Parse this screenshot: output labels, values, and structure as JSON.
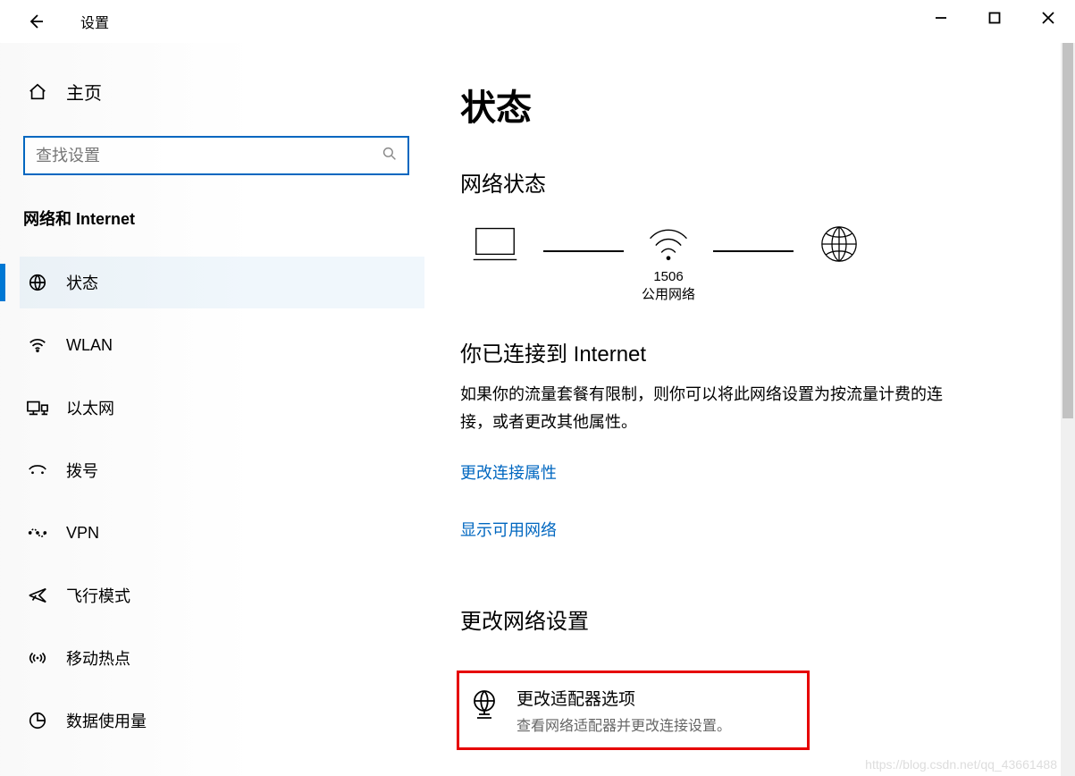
{
  "titlebar": {
    "app_name": "设置"
  },
  "sidebar": {
    "home_label": "主页",
    "search_placeholder": "查找设置",
    "section_title": "网络和 Internet",
    "items": [
      {
        "label": "状态",
        "selected": true
      },
      {
        "label": "WLAN"
      },
      {
        "label": "以太网"
      },
      {
        "label": "拨号"
      },
      {
        "label": "VPN"
      },
      {
        "label": "飞行模式"
      },
      {
        "label": "移动热点"
      },
      {
        "label": "数据使用量"
      }
    ]
  },
  "main": {
    "page_title": "状态",
    "network_status_heading": "网络状态",
    "diagram": {
      "wifi_name": "1506",
      "wifi_type": "公用网络"
    },
    "connected_title": "你已连接到 Internet",
    "connected_desc": "如果你的流量套餐有限制，则你可以将此网络设置为按流量计费的连接，或者更改其他属性。",
    "link_change_props": "更改连接属性",
    "link_show_networks": "显示可用网络",
    "change_settings_heading": "更改网络设置",
    "adapter_option_title": "更改适配器选项",
    "adapter_option_desc": "查看网络适配器并更改连接设置。",
    "watermark": "https://blog.csdn.net/qq_43661488"
  }
}
